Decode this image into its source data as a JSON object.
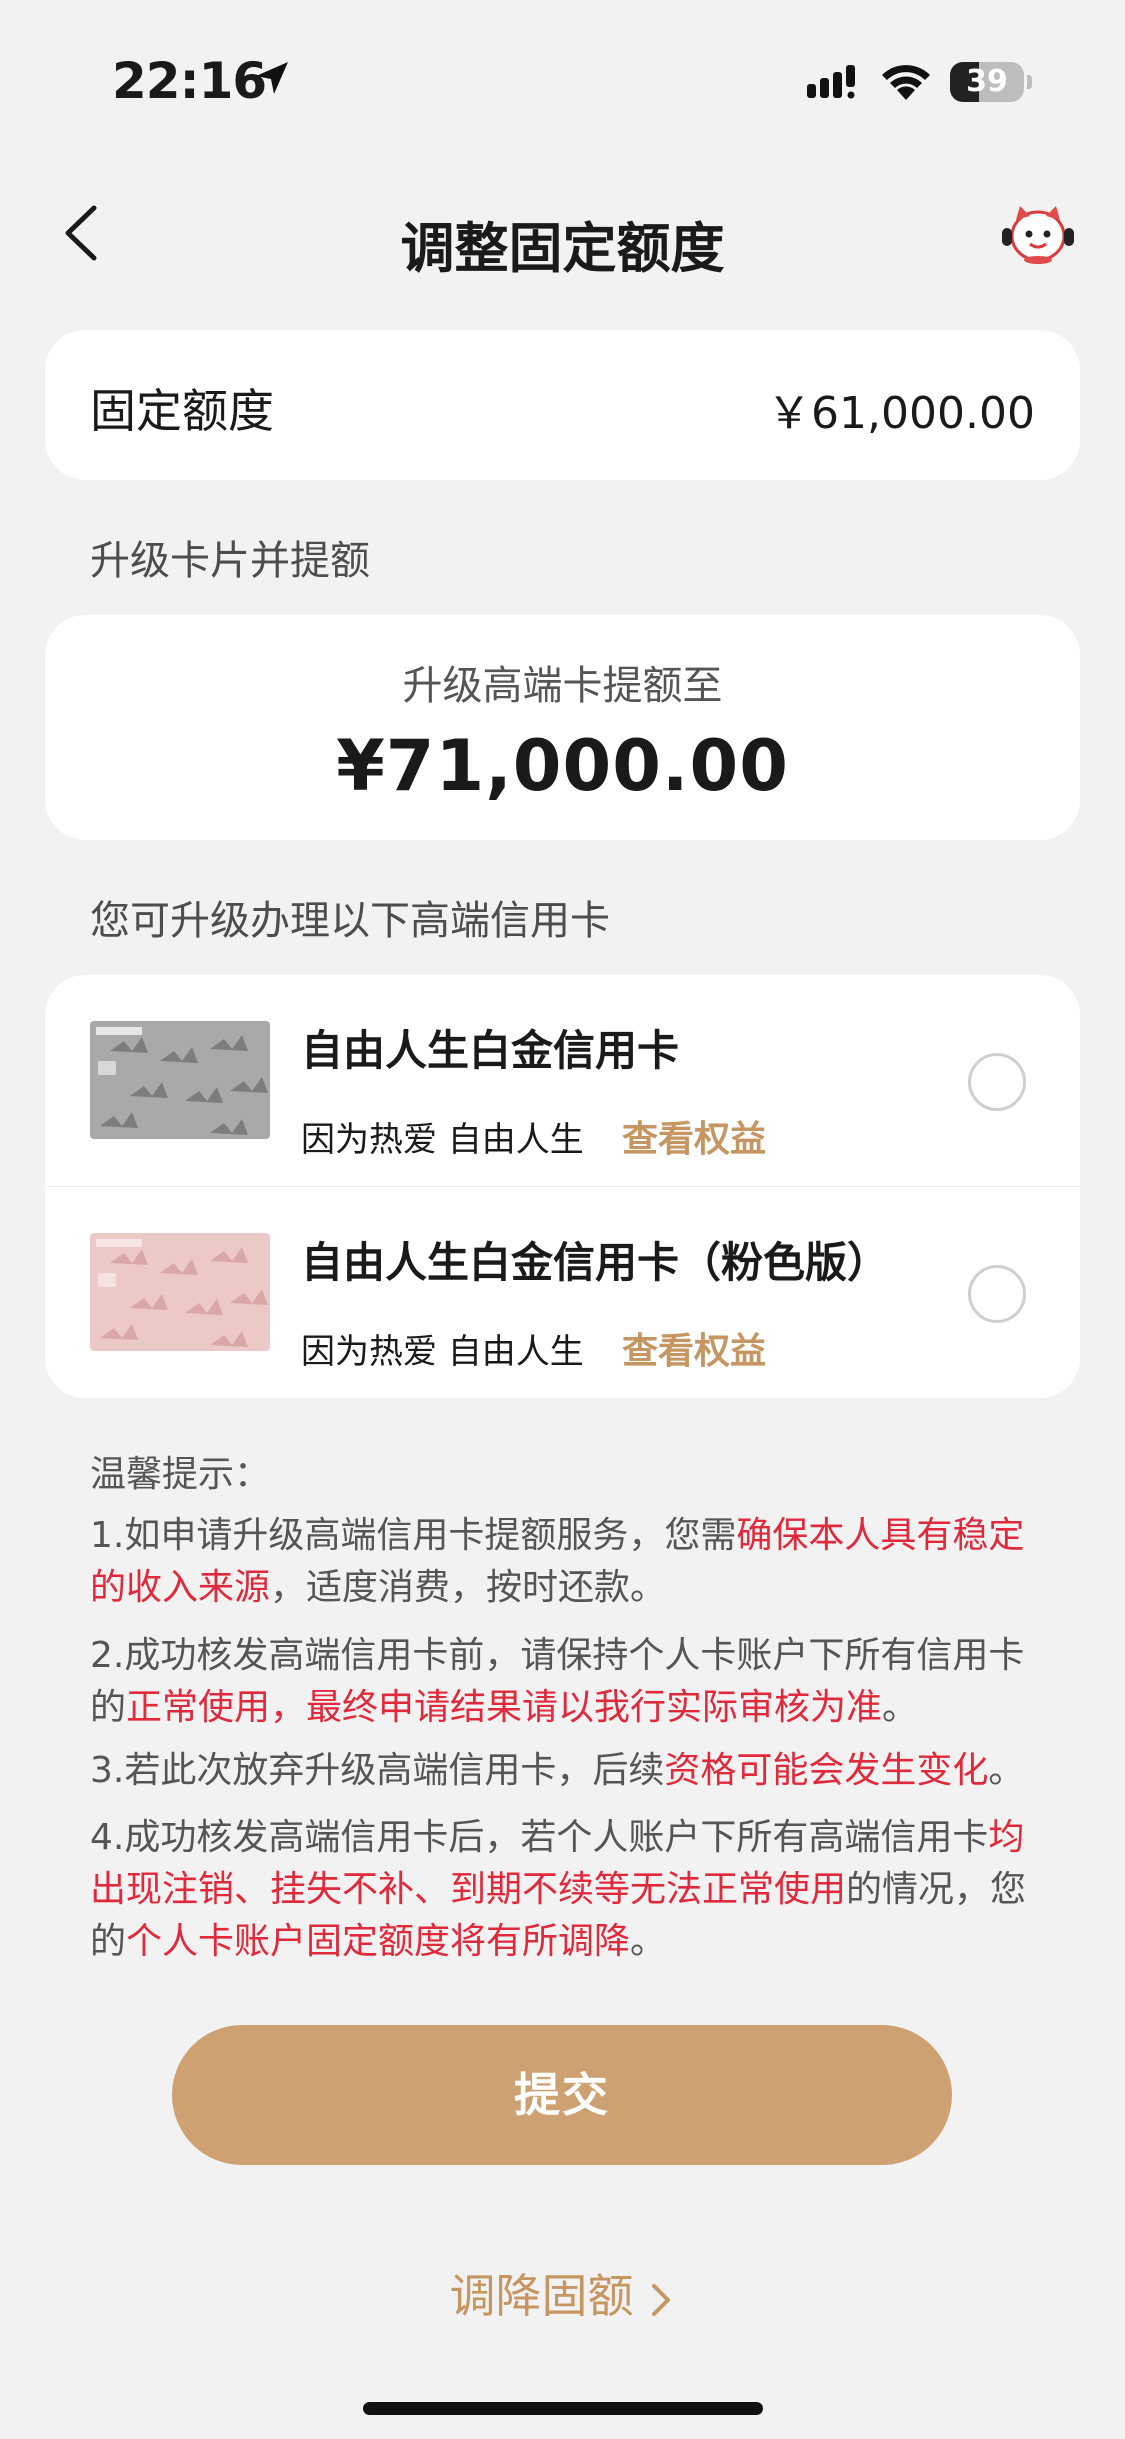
{
  "status_bar": {
    "time": "22:16",
    "battery": "39",
    "battery_level": 0.39,
    "icons": [
      "location-arrow-icon",
      "signal-icon",
      "wifi-icon",
      "battery-icon"
    ]
  },
  "nav": {
    "title": "调整固定额度",
    "back_icon": "chevron-left-icon",
    "mascot_icon": "mascot-icon"
  },
  "fixed_limit": {
    "label": "固定额度",
    "value": "￥61,000.00"
  },
  "upgrade_section_title": "升级卡片并提额",
  "upgrade": {
    "subtitle": "升级高端卡提额至",
    "amount": "¥71,000.00"
  },
  "cards_section_title": "您可升级办理以下高端信用卡",
  "cards": [
    {
      "name": "自由人生白金信用卡",
      "slogan": "因为热爱 自由人生",
      "link": "查看权益",
      "selected": false,
      "card_color": "#a9a9a9"
    },
    {
      "name": "自由人生白金信用卡（粉色版）",
      "slogan": "因为热爱 自由人生",
      "link": "查看权益",
      "selected": false,
      "card_color": "#e8c2c0"
    }
  ],
  "tips": {
    "title": "温馨提示：",
    "items": [
      {
        "p1": "1.如申请升级高端信用卡提额服务，您需",
        "r1": "确保本人具有稳定的收入来源",
        "p2": "，适度消费，按时还款。"
      },
      {
        "p1": "2.成功核发高端信用卡前，请保持个人卡账户下所有信用卡的",
        "r1": "正常使用，最终申请结果请以我行实际审核为准",
        "p2": "。"
      },
      {
        "p1": "3.若此次放弃升级高端信用卡，后续",
        "r1": "资格可能会发生变化",
        "p2": "。"
      },
      {
        "p1": "4.成功核发高端信用卡后，若个人账户下所有高端信用卡",
        "r1": "均出现注销、挂失不补、到期不续等无法正常使用",
        "p2": "的情况，您的",
        "r2": "个人卡账户固定额度将有所调降",
        "p3": "。"
      }
    ]
  },
  "submit_label": "提交",
  "reduce_link": "调降固额",
  "colors": {
    "accent": "#cda171",
    "link": "#c59662",
    "warning": "#e0293a",
    "background": "#f2f2f2"
  }
}
